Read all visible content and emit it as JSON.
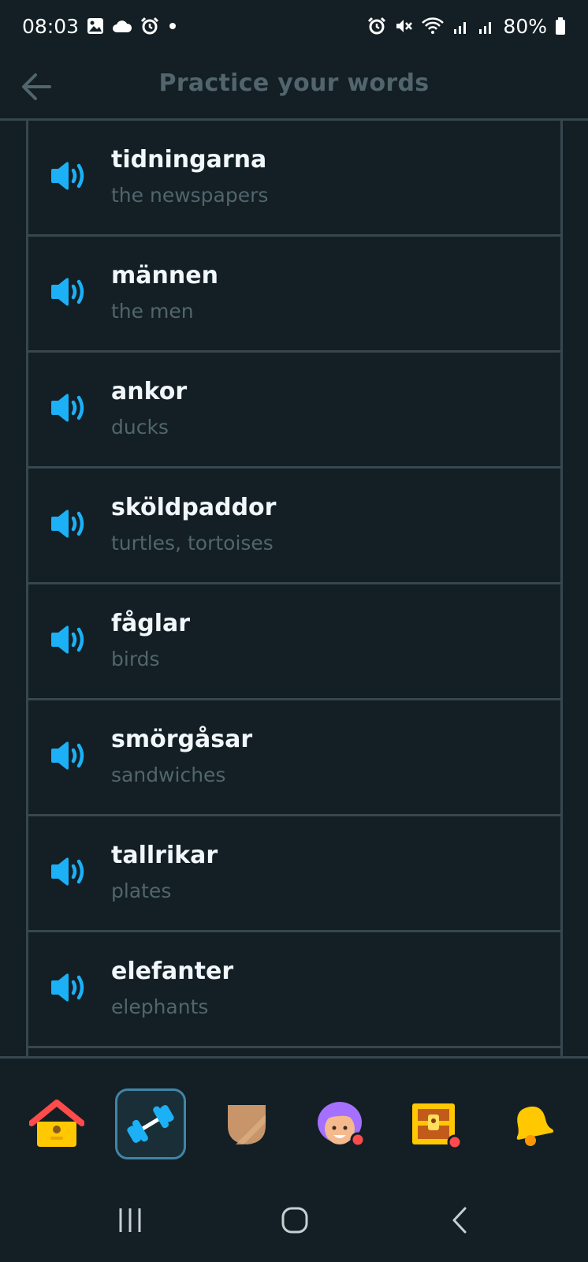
{
  "status_bar": {
    "time": "08:03",
    "battery": "80%",
    "left_icons": [
      "gallery-icon",
      "cloud-icon",
      "alarm-icon",
      "dot-icon"
    ],
    "right_icons": [
      "alarm-icon",
      "mute-icon",
      "wifi-icon",
      "signal-icon",
      "signal-icon",
      "battery-icon"
    ]
  },
  "header": {
    "title": "Practice your words",
    "back_icon": "arrow-left-icon"
  },
  "words": [
    {
      "word": "tidningarna",
      "meaning": "the newspapers"
    },
    {
      "word": "männen",
      "meaning": "the men"
    },
    {
      "word": "ankor",
      "meaning": "ducks"
    },
    {
      "word": "sköldpaddor",
      "meaning": "turtles, tortoises"
    },
    {
      "word": "fåglar",
      "meaning": "birds"
    },
    {
      "word": "smörgåsar",
      "meaning": "sandwiches"
    },
    {
      "word": "tallrikar",
      "meaning": "plates"
    },
    {
      "word": "elefanter",
      "meaning": "elephants"
    }
  ],
  "tabs": [
    {
      "name": "home",
      "icon": "house-icon",
      "active": false
    },
    {
      "name": "practice",
      "icon": "dumbbell-icon",
      "active": true
    },
    {
      "name": "leagues",
      "icon": "shield-icon",
      "active": false
    },
    {
      "name": "profile",
      "icon": "avatar-icon",
      "active": false
    },
    {
      "name": "shop",
      "icon": "treasure-chest-icon",
      "active": false
    },
    {
      "name": "notifications",
      "icon": "bell-icon",
      "active": false
    }
  ],
  "colors": {
    "background": "#131f24",
    "border": "#37464f",
    "speaker": "#1cb0f6",
    "title": "#52656d",
    "active_tab": "#3f85a7"
  }
}
